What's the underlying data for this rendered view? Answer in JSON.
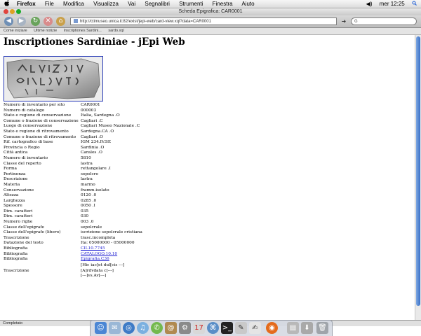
{
  "menubar": {
    "apple": "",
    "items": [
      "Firefox",
      "File",
      "Modifica",
      "Visualizza",
      "Vai",
      "Segnalibri",
      "Strumenti",
      "Finestra",
      "Aiuto"
    ],
    "clock": "mer 12:25"
  },
  "window": {
    "title": "Scheda Epigrafica: CAR0001"
  },
  "toolbar": {
    "url": "http://ctimuseo.unica.it:82/exist/jepi-web/card-view.xql?data=CAR0001",
    "search_placeholder": "G"
  },
  "bookmarks": [
    "Come iniziare",
    "Ultime notizie",
    "Inscriptiones Sardini...",
    "sardo.xql"
  ],
  "page": {
    "title": "Inscriptiones Sardiniae - jEpi Web",
    "rows": [
      {
        "label": "Numero di inventario per sito",
        "value": "CAR0001"
      },
      {
        "label": "Numero di catalogo",
        "value": "000003"
      },
      {
        "label": "Stato e regione di conservazione",
        "value": "Italia, Sardegna .O"
      },
      {
        "label": "Comune o frazione di conservazione",
        "value": "Cagliari .C"
      },
      {
        "label": "Luogo di conservazione",
        "value": "Cagliari Museo Nazionale .C"
      },
      {
        "label": "Stato e regione di ritrovamento",
        "value": "Sardegna.CA .O"
      },
      {
        "label": "Comune o frazione di ritrovamento",
        "value": "Cagliari .O"
      },
      {
        "label": "Rif. cartografico di base",
        "value": "IGM 234.IV.SE"
      },
      {
        "label": "Provincia o Regio",
        "value": "Sardinia .O"
      },
      {
        "label": "Città antica",
        "value": "Carales .O"
      },
      {
        "label": "Numero di inventario",
        "value": "5810"
      },
      {
        "label": "Classe del reperto",
        "value": "lastra"
      },
      {
        "label": "Forma",
        "value": "rettangolare .I"
      },
      {
        "label": "Pertinenza",
        "value": "sepolcro"
      },
      {
        "label": "Descrizione",
        "value": "lastra"
      },
      {
        "label": "Materia",
        "value": "marmo"
      },
      {
        "label": "Conservazione",
        "value": "framm.isolato"
      },
      {
        "label": "Altezza",
        "value": "0120 .0"
      },
      {
        "label": "Larghezza",
        "value": "0285 .0"
      },
      {
        "label": "Spessore",
        "value": "0050 .I"
      },
      {
        "label": "Dim. caratteri",
        "value": "035"
      },
      {
        "label": "Dim. caratteri",
        "value": "030"
      },
      {
        "label": "Numero righe",
        "value": "003 .0"
      },
      {
        "label": "Classe dell'epigrafe",
        "value": "sepolcrale"
      },
      {
        "label": "Classe dell'epigrafe (libero)",
        "value": "iscrizione sepolcrale cristiana"
      },
      {
        "label": "Trascrizione",
        "value": "trasc.incompleta"
      },
      {
        "label": "Datazione del testo",
        "value": "Ita: 05000000 - 05000000"
      }
    ],
    "links": [
      {
        "label": "Bibliografia",
        "value": "CIL10.7745"
      },
      {
        "label": "Bibliografia",
        "value": "CATALOGO.10.10"
      },
      {
        "label": "Bibliografia",
        "value": "Epigrafia.C36"
      }
    ],
    "transcription": {
      "label": "Trascrizione",
      "lines": [
        "[Hic iac]et dul[cis ---]",
        "[A]rdvdata c[---]",
        "[---]vs.Av[---]"
      ]
    }
  },
  "statusbar": {
    "text": "Completato"
  },
  "dock": {
    "icons": [
      "finder-icon",
      "mail-icon",
      "safari-icon",
      "itunes-icon",
      "ichat-icon",
      "address-book-icon",
      "terminal-icon",
      "preview-icon",
      "firefox-icon",
      "trash-icon"
    ]
  },
  "colors": {
    "link": "#1a1ad0",
    "photo_border": "#2a3db8",
    "scroll_thumb": "#3a6fc6"
  }
}
